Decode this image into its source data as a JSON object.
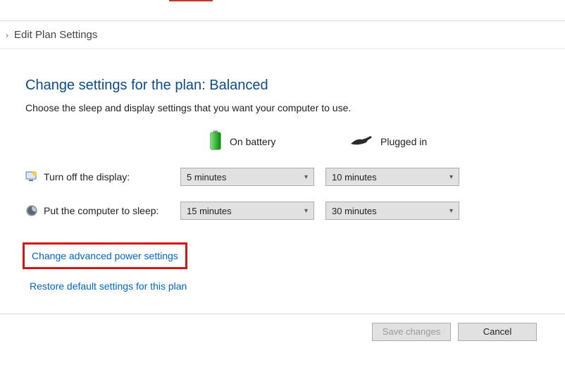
{
  "breadcrumb": {
    "label": "Edit Plan Settings"
  },
  "page": {
    "title": "Change settings for the plan: Balanced",
    "description": "Choose the sleep and display settings that you want your computer to use."
  },
  "columns": {
    "battery": "On battery",
    "plugged": "Plugged in"
  },
  "rows": {
    "display": {
      "label": "Turn off the display:",
      "battery_value": "5 minutes",
      "plugged_value": "10 minutes"
    },
    "sleep": {
      "label": "Put the computer to sleep:",
      "battery_value": "15 minutes",
      "plugged_value": "30 minutes"
    }
  },
  "links": {
    "advanced": "Change advanced power settings",
    "restore": "Restore default settings for this plan"
  },
  "buttons": {
    "save": "Save changes",
    "cancel": "Cancel"
  }
}
